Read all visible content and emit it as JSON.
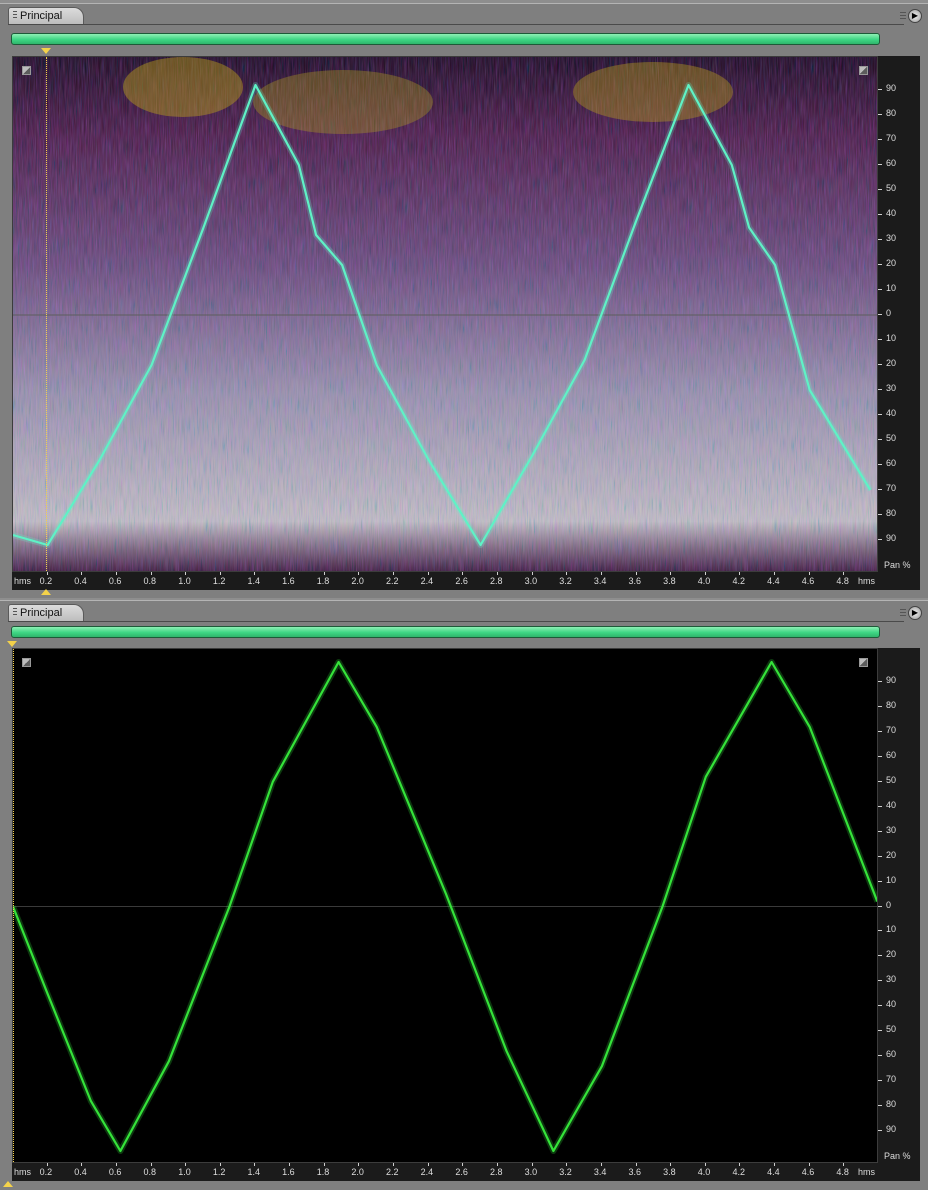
{
  "panels": [
    {
      "tab_label": "Principal",
      "view": "spectral-pan",
      "chart_data": {
        "type": "line",
        "xlabel": "hms",
        "ylabel": "Pan %",
        "x_ticks": [
          "0.2",
          "0.4",
          "0.6",
          "0.8",
          "1.0",
          "1.2",
          "1.4",
          "1.6",
          "1.8",
          "2.0",
          "2.2",
          "2.4",
          "2.6",
          "2.8",
          "3.0",
          "3.2",
          "3.4",
          "3.6",
          "3.8",
          "4.0",
          "4.2",
          "4.4",
          "4.6",
          "4.8"
        ],
        "y_ticks": [
          "90",
          "80",
          "70",
          "60",
          "50",
          "40",
          "30",
          "20",
          "10",
          "0",
          "10",
          "20",
          "30",
          "40",
          "50",
          "60",
          "70",
          "80",
          "90"
        ],
        "xlim": [
          0.0,
          5.0
        ],
        "ylim": [
          -100,
          100
        ],
        "series": [
          {
            "color": "#5ff2c6",
            "x": [
              0.0,
              0.2,
              0.5,
              0.8,
              1.1,
              1.4,
              1.65,
              1.75,
              1.9,
              2.1,
              2.4,
              2.7,
              3.0,
              3.3,
              3.6,
              3.9,
              4.15,
              4.25,
              4.4,
              4.6,
              4.95
            ],
            "y": [
              -88,
              -92,
              -58,
              -20,
              35,
              92,
              60,
              32,
              20,
              -20,
              -58,
              -92,
              -56,
              -18,
              38,
              92,
              60,
              35,
              20,
              -30,
              -70
            ]
          }
        ]
      }
    },
    {
      "tab_label": "Principal",
      "view": "pan",
      "chart_data": {
        "type": "line",
        "xlabel": "hms",
        "ylabel": "Pan %",
        "x_ticks": [
          "0.2",
          "0.4",
          "0.6",
          "0.8",
          "1.0",
          "1.2",
          "1.4",
          "1.6",
          "1.8",
          "2.0",
          "2.2",
          "2.4",
          "2.6",
          "2.8",
          "3.0",
          "3.2",
          "3.4",
          "3.6",
          "3.8",
          "4.0",
          "4.2",
          "4.4",
          "4.6",
          "4.8"
        ],
        "y_ticks": [
          "90",
          "80",
          "70",
          "60",
          "50",
          "40",
          "30",
          "20",
          "10",
          "0",
          "10",
          "20",
          "30",
          "40",
          "50",
          "60",
          "70",
          "80",
          "90"
        ],
        "xlim": [
          0.0,
          5.0
        ],
        "ylim": [
          -100,
          100
        ],
        "series": [
          {
            "color": "#35e33a",
            "x": [
              0.0,
              0.2,
              0.45,
              0.62,
              0.9,
              1.25,
              1.5,
              1.88,
              2.1,
              2.5,
              2.85,
              3.12,
              3.4,
              3.75,
              4.0,
              4.38,
              4.6,
              4.99
            ],
            "y": [
              0,
              -35,
              -78,
              -98,
              -62,
              0,
              50,
              98,
              72,
              5,
              -58,
              -98,
              -64,
              0,
              52,
              98,
              72,
              2
            ]
          }
        ]
      }
    }
  ]
}
